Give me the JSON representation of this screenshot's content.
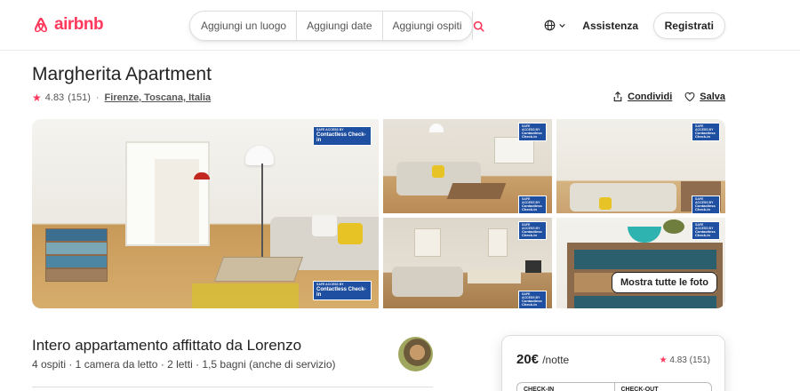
{
  "header": {
    "logo_text": "airbnb",
    "brand_color": "#ff385c",
    "search": {
      "where": "Aggiungi un luogo",
      "dates": "Aggiungi date",
      "guests": "Aggiungi ospiti",
      "search_icon": "search-icon"
    },
    "language_icon": "globe-icon",
    "assistenza": "Assistenza",
    "registrati": "Registrati"
  },
  "listing": {
    "title": "Margherita Apartment",
    "rating": "4.83",
    "reviews": "(151)",
    "separator": "·",
    "location": "Firenze, Toscana, Italia",
    "share": "Condividi",
    "save": "Salva"
  },
  "gallery": {
    "badge_top": "SAFE ACCESS BY",
    "badge_main": "Contactless Check-in",
    "show_all": "Mostra tutte le foto"
  },
  "details": {
    "host_title": "Intero appartamento affittato da Lorenzo",
    "host_sub": "4 ospiti · 1 camera da letto · 2 letti · 1,5 bagni (anche di servizio)"
  },
  "booking": {
    "price": "20€",
    "unit": "/notte",
    "rating": "4.83",
    "reviews": "(151)",
    "checkin": "CHECK-IN",
    "checkout": "CHECK-OUT"
  }
}
